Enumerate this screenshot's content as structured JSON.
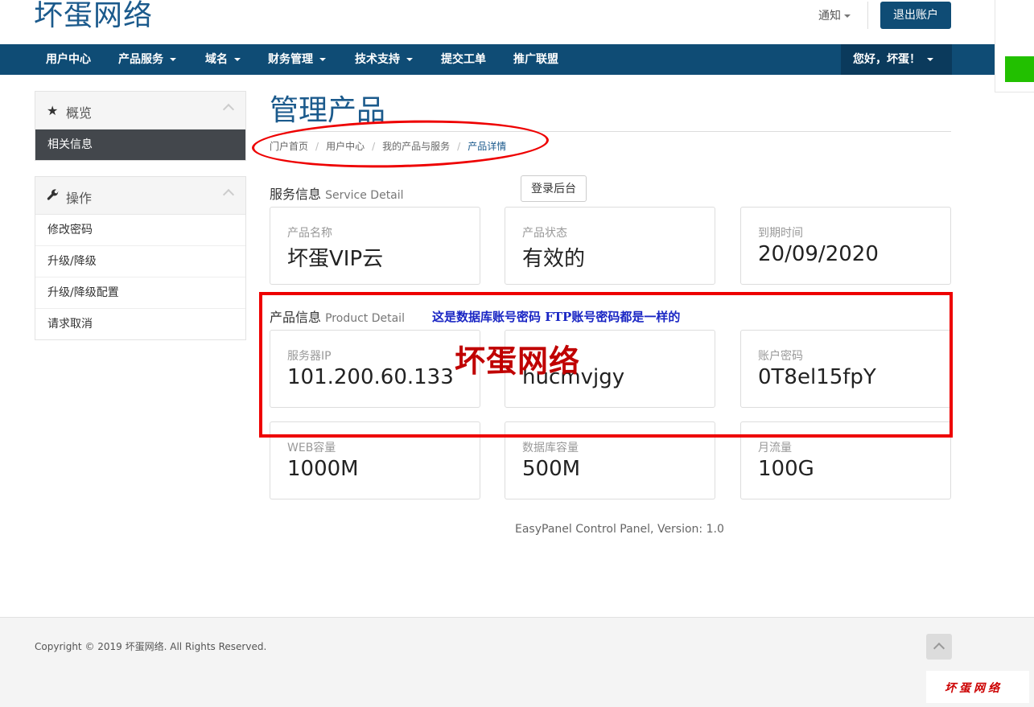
{
  "header": {
    "logo": "坏蛋网络",
    "notify_label": "通知",
    "logout_label": "退出账户"
  },
  "nav": {
    "items": [
      {
        "label": "用户中心",
        "has_caret": false
      },
      {
        "label": "产品服务",
        "has_caret": true
      },
      {
        "label": "域名",
        "has_caret": true
      },
      {
        "label": "财务管理",
        "has_caret": true
      },
      {
        "label": "技术支持",
        "has_caret": true
      },
      {
        "label": "提交工单",
        "has_caret": false
      },
      {
        "label": "推广联盟",
        "has_caret": false
      }
    ],
    "greeting": "您好，坏蛋！"
  },
  "sidebar": {
    "overview": {
      "title": "概览",
      "icon": "star-icon",
      "items": [
        "相关信息"
      ]
    },
    "actions": {
      "title": "操作",
      "icon": "wrench-icon",
      "items": [
        "修改密码",
        "升级/降级",
        "升级/降级配置",
        "请求取消"
      ]
    }
  },
  "main": {
    "page_title": "管理产品",
    "breadcrumb": [
      "门户首页",
      "用户中心",
      "我的产品与服务",
      "产品详情"
    ],
    "service_section": {
      "title": "服务信息",
      "title_en": "Service Detail"
    },
    "login_backend_label": "登录后台",
    "service_cards": [
      {
        "label": "产品名称",
        "value": "坏蛋VIP云"
      },
      {
        "label": "产品状态",
        "value": "有效的"
      },
      {
        "label": "到期时间",
        "value": "20/09/2020"
      }
    ],
    "product_section": {
      "title": "产品信息",
      "title_en": "Product Detail"
    },
    "product_cards_row1": [
      {
        "label": "服务器IP",
        "value": "101.200.60.133"
      },
      {
        "label": "",
        "value": "hucmvjgy"
      },
      {
        "label": "账户密码",
        "value": "0T8el15fpY"
      }
    ],
    "product_cards_row2": [
      {
        "label": "WEB容量",
        "value": "1000M"
      },
      {
        "label": "数据库容量",
        "value": "500M"
      },
      {
        "label": "月流量",
        "value": "100G"
      }
    ],
    "version": "EasyPanel Control Panel, Version: 1.0"
  },
  "annotations": {
    "note": "这是数据库账号密码  FTP账号密码都是一样的",
    "overlay_brand": "坏蛋网络"
  },
  "footer": {
    "copyright": "Copyright © 2019 坏蛋网络. All Rights Reserved.",
    "watermark": "坏蛋网络"
  },
  "colors": {
    "brand_blue": "#0f4c75",
    "annotation_red": "#ee0000",
    "annotation_blue": "#1a26c4"
  }
}
